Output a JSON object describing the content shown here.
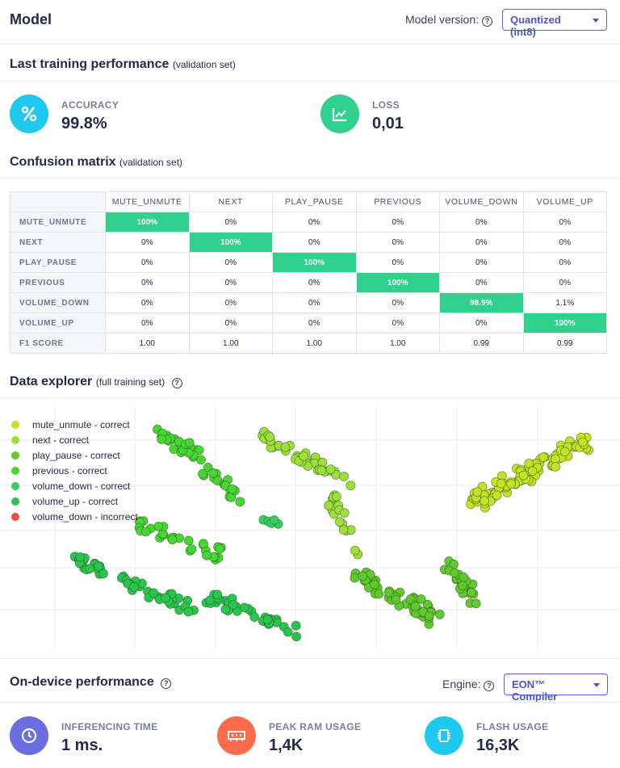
{
  "header": {
    "title": "Model",
    "version_label": "Model version:",
    "version_value": "Quantized (int8)"
  },
  "training": {
    "title": "Last training performance",
    "note": "(validation set)",
    "accuracy": {
      "label": "ACCURACY",
      "value": "99.8%",
      "icon": "percent-icon",
      "color": "#1fc8ee"
    },
    "loss": {
      "label": "LOSS",
      "value": "0,01",
      "icon": "chart-icon",
      "color": "#2fd18c"
    }
  },
  "confusion": {
    "title": "Confusion matrix",
    "note": "(validation set)",
    "columns": [
      "MUTE_UNMUTE",
      "NEXT",
      "PLAY_PAUSE",
      "PREVIOUS",
      "VOLUME_DOWN",
      "VOLUME_UP"
    ],
    "rows": [
      {
        "label": "MUTE_UNMUTE",
        "cells": [
          "100%",
          "0%",
          "0%",
          "0%",
          "0%",
          "0%"
        ]
      },
      {
        "label": "NEXT",
        "cells": [
          "0%",
          "100%",
          "0%",
          "0%",
          "0%",
          "0%"
        ]
      },
      {
        "label": "PLAY_PAUSE",
        "cells": [
          "0%",
          "0%",
          "100%",
          "0%",
          "0%",
          "0%"
        ]
      },
      {
        "label": "PREVIOUS",
        "cells": [
          "0%",
          "0%",
          "0%",
          "100%",
          "0%",
          "0%"
        ]
      },
      {
        "label": "VOLUME_DOWN",
        "cells": [
          "0%",
          "0%",
          "0%",
          "0%",
          "98.9%",
          "1.1%"
        ]
      },
      {
        "label": "VOLUME_UP",
        "cells": [
          "0%",
          "0%",
          "0%",
          "0%",
          "0%",
          "100%"
        ]
      }
    ],
    "f1": {
      "label": "F1 SCORE",
      "cells": [
        "1.00",
        "1.00",
        "1.00",
        "1.00",
        "0.99",
        "0.99"
      ]
    },
    "highlight_color": "#2fd18c"
  },
  "explorer": {
    "title": "Data explorer",
    "note": "(full training set)",
    "legend": [
      {
        "label": "mute_unmute - correct",
        "color": "#c5e324"
      },
      {
        "label": "next - correct",
        "color": "#9ee03a"
      },
      {
        "label": "play_pause - correct",
        "color": "#5fc92e"
      },
      {
        "label": "previous - correct",
        "color": "#46d734"
      },
      {
        "label": "volume_down - correct",
        "color": "#33d15e"
      },
      {
        "label": "volume_up - correct",
        "color": "#28c54f"
      },
      {
        "label": "volume_down - incorrect",
        "color": "#e4533b"
      }
    ]
  },
  "device": {
    "title": "On-device performance",
    "engine_label": "Engine:",
    "engine_value": "EON™ Compiler",
    "inferencing": {
      "label": "INFERENCING TIME",
      "value": "1 ms.",
      "icon": "clock-icon",
      "color": "#6a6fe0"
    },
    "ram": {
      "label": "PEAK RAM USAGE",
      "value": "1,4K",
      "icon": "memory-icon",
      "color": "#fd6a4c"
    },
    "flash": {
      "label": "FLASH USAGE",
      "value": "16,3K",
      "icon": "chip-icon",
      "color": "#1fc8ee"
    }
  }
}
